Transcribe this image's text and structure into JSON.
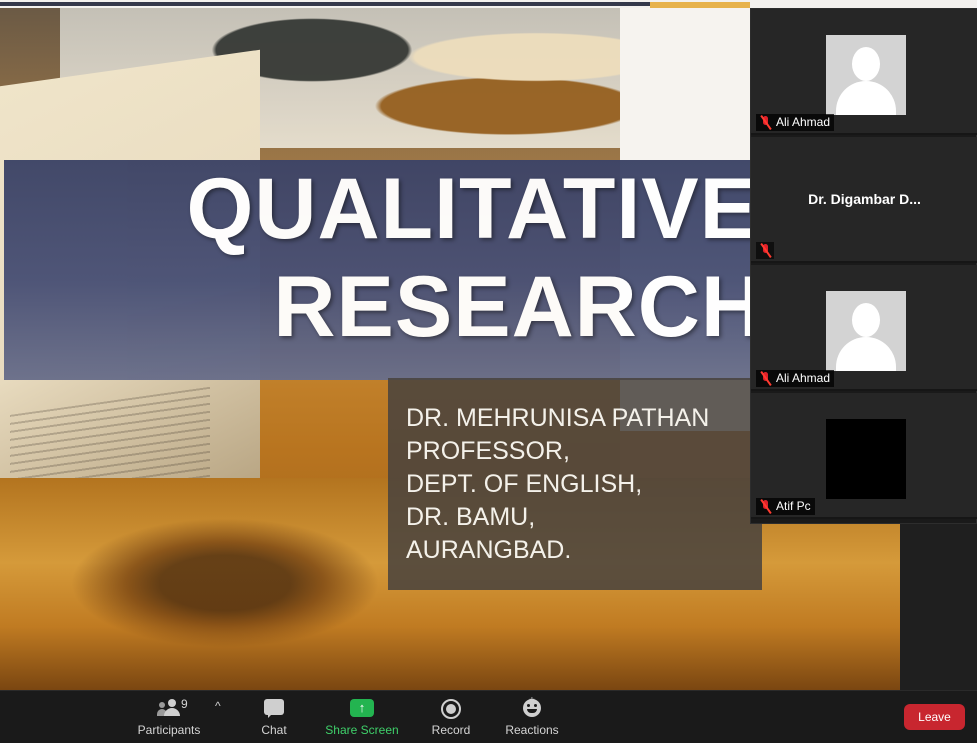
{
  "slide": {
    "title_line1": "QUALITATIVE",
    "title_line2": "RESEARCH",
    "author_lines": [
      "DR. MEHRUNISA PATHAN",
      "PROFESSOR,",
      "DEPT. OF ENGLISH,",
      "DR. BAMU,",
      "AURANGBAD."
    ]
  },
  "participants": [
    {
      "name": "Ali Ahmad",
      "video": "avatar",
      "muted": true
    },
    {
      "name": "Dr. Digambar D...",
      "video": "name-only",
      "muted": true
    },
    {
      "name": "Ali Ahmad",
      "video": "avatar",
      "muted": true
    },
    {
      "name": "Atif Pc",
      "video": "black",
      "muted": true
    }
  ],
  "toolbar": {
    "participants_label": "Participants",
    "participants_count": "9",
    "caret": "^",
    "chat_label": "Chat",
    "share_label": "Share Screen",
    "share_icon": "↑",
    "record_label": "Record",
    "reactions_label": "Reactions",
    "reactions_plus": "+",
    "leave_label": "Leave"
  },
  "colors": {
    "leave": "#c8262f",
    "share": "#23b450",
    "banner": "#444b6e"
  }
}
